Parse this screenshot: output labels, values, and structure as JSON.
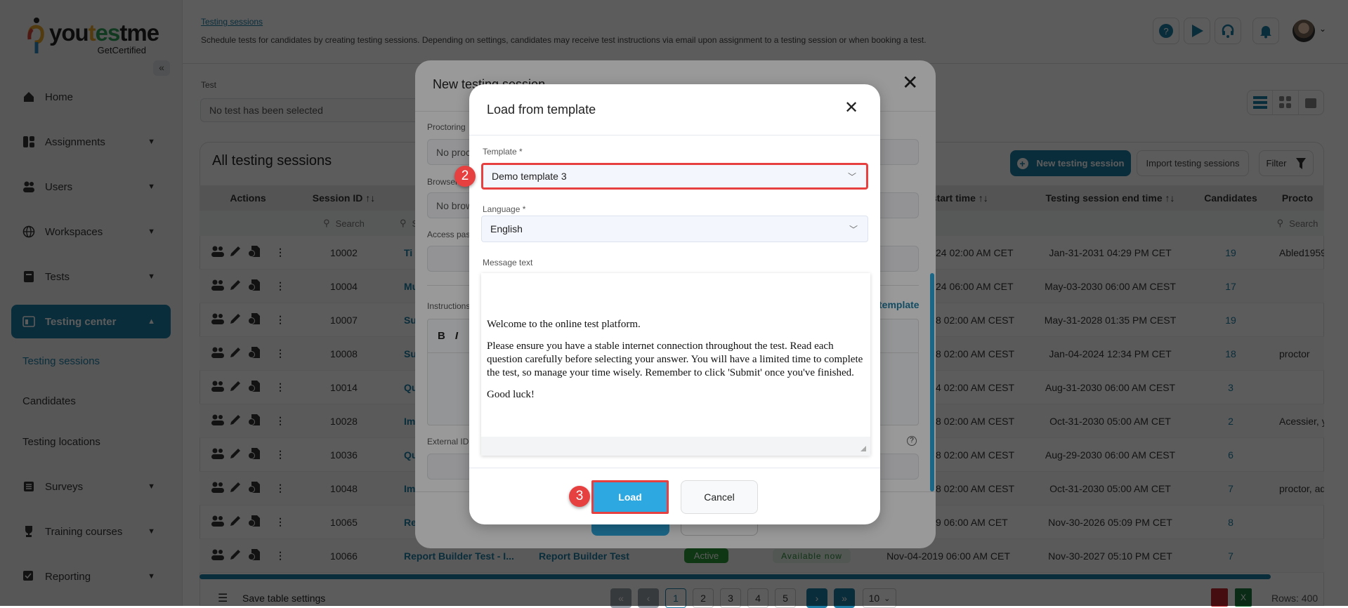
{
  "brand": {
    "name_part1": "you",
    "name_part2": "t",
    "name_part3": "es",
    "name_part4": "tme",
    "tagline": "GetCertified"
  },
  "sidebar": {
    "collapse_icon": "double-chevron-left",
    "items": [
      {
        "label": "Home",
        "icon": "home-icon"
      },
      {
        "label": "Assignments",
        "icon": "assignments-icon"
      },
      {
        "label": "Users",
        "icon": "users-icon"
      },
      {
        "label": "Workspaces",
        "icon": "globe-icon"
      },
      {
        "label": "Tests",
        "icon": "tests-icon"
      },
      {
        "label": "Testing center",
        "icon": "testing-center-icon",
        "active": true
      },
      {
        "label": "Surveys",
        "icon": "surveys-icon"
      },
      {
        "label": "Training courses",
        "icon": "trophy-icon"
      },
      {
        "label": "Reporting",
        "icon": "reporting-icon"
      }
    ],
    "subitems": [
      "Testing sessions",
      "Candidates",
      "Testing locations"
    ]
  },
  "header": {
    "breadcrumb": "Testing sessions",
    "description": "Schedule tests for candidates by creating testing sessions. Depending on settings, candidates may receive test instructions via email upon assignment to a testing session or when booking a test.",
    "icons": [
      "help-icon",
      "play-icon",
      "support-headset-icon",
      "bell-icon"
    ]
  },
  "filter": {
    "test_label": "Test",
    "test_value": "No test has been selected"
  },
  "card": {
    "title": "All testing sessions",
    "new_button": "New testing session",
    "import_button": "Import testing sessions",
    "filter_button": "Filter"
  },
  "table": {
    "headers": [
      "Actions",
      "Session ID ↑↓",
      "Tes",
      "",
      "",
      "",
      "sion start time ↑↓",
      "Testing session end time ↑↓",
      "Candidates",
      "Procto"
    ],
    "search_placeholder": "Search",
    "rows": [
      {
        "id": "10002",
        "name": "Ti",
        "start": "24 02:00 AM CET",
        "end": "Jan-31-2031 04:29 PM CET",
        "candidates": "19",
        "proctors": "Abled1959,"
      },
      {
        "id": "10004",
        "name": "Mu",
        "start": "24 06:00 AM CET",
        "end": "May-03-2030 06:00 AM CEST",
        "candidates": "17",
        "proctors": ""
      },
      {
        "id": "10007",
        "name": "Su",
        "start": "8 02:00 AM CEST",
        "end": "May-31-2028 01:35 PM CEST",
        "candidates": "19",
        "proctors": ""
      },
      {
        "id": "10008",
        "name": "Su",
        "start": "8 02:00 AM CEST",
        "end": "Jan-04-2024 12:34 PM CET",
        "candidates": "18",
        "proctors": "proctor"
      },
      {
        "id": "10014",
        "name": "Qu",
        "start": "4 02:00 AM CEST",
        "end": "Aug-31-2030 06:00 AM CEST",
        "candidates": "3",
        "proctors": ""
      },
      {
        "id": "10028",
        "name": "Im",
        "start": "8 02:00 AM CEST",
        "end": "Oct-31-2030 05:00 AM CET",
        "candidates": "2",
        "proctors": "Acessier, yt"
      },
      {
        "id": "10036",
        "name": "Qu",
        "start": "8 02:00 AM CEST",
        "end": "Aug-29-2030 06:00 AM CEST",
        "candidates": "6",
        "proctors": ""
      },
      {
        "id": "10048",
        "name": "Im",
        "start": "8 02:00 AM CEST",
        "end": "Oct-31-2030 05:00 AM CET",
        "candidates": "7",
        "proctors": "proctor, adr"
      },
      {
        "id": "10065",
        "name": "Re",
        "start": "9 06:00 AM CET",
        "end": "Nov-30-2026 05:09 PM CET",
        "candidates": "8",
        "proctors": ""
      },
      {
        "id": "10066",
        "name": "Report Builder Test - I...",
        "test": "Report Builder Test",
        "status": "Active",
        "availability": "Available now",
        "start": "Nov-04-2019 06:00 AM CET",
        "end": "Nov-30-2027 05:10 PM CET",
        "candidates": "7",
        "proctors": ""
      }
    ]
  },
  "footer": {
    "save_settings": "Save table settings",
    "pages": [
      "1",
      "2",
      "3",
      "4",
      "5"
    ],
    "current_page": "1",
    "page_size": "10",
    "rows": "Rows: 400"
  },
  "new_session_modal": {
    "title": "New testing session",
    "proctoring_label": "Proctoring",
    "proctoring_value": "No proc",
    "browser_label": "Browser",
    "browser_value": "No brow",
    "access_label": "Access pas",
    "instructions_label": "Instructions",
    "bold": "B",
    "italic": "I",
    "template_link": "template",
    "external_id_label": "External ID"
  },
  "template_modal": {
    "title": "Load from template",
    "template_label": "Template *",
    "template_value": "Demo template 3",
    "language_label": "Language *",
    "language_value": "English",
    "message_label": "Message text",
    "message_paragraphs": [
      "Welcome to the online test platform.",
      "Please ensure you have a stable internet connection throughout the test. Read each question carefully before selecting your answer. You will have a limited time to complete the test, so manage your time wisely. Remember to click 'Submit' once you've finished.",
      "Good luck!"
    ],
    "load_button": "Load",
    "cancel_button": "Cancel",
    "step_template": "2",
    "step_load": "3"
  },
  "colors": {
    "accent": "#1f7fa6",
    "load_button": "#2ea8e0",
    "step_badge": "#e64040",
    "highlight_border": "#e64040",
    "active_badge": "#2a9a3a"
  }
}
